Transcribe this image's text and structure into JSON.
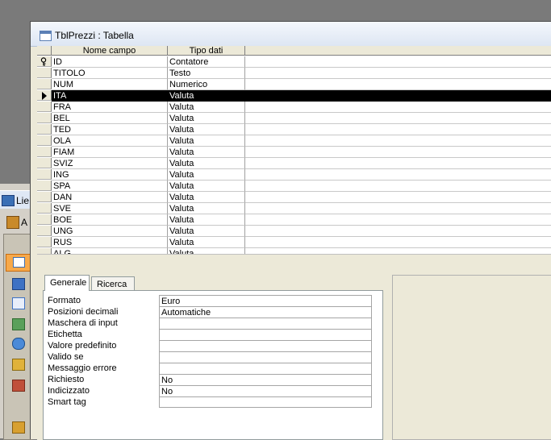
{
  "background_window": {
    "title_fragment": "Lie",
    "toolbar_fragment": "A",
    "object_icons": [
      "table-icon",
      "query-icon",
      "form-icon",
      "report-icon",
      "page-icon",
      "macro-icon",
      "module-icon"
    ]
  },
  "window": {
    "title": "TblPrezzi : Tabella"
  },
  "grid": {
    "headers": [
      "Nome campo",
      "Tipo dati"
    ],
    "rows": [
      {
        "name": "ID",
        "type": "Contatore",
        "key": true
      },
      {
        "name": "TITOLO",
        "type": "Testo"
      },
      {
        "name": "NUM",
        "type": "Numerico"
      },
      {
        "name": "ITA",
        "type": "Valuta",
        "active": true
      },
      {
        "name": "FRA",
        "type": "Valuta"
      },
      {
        "name": "BEL",
        "type": "Valuta"
      },
      {
        "name": "TED",
        "type": "Valuta"
      },
      {
        "name": "OLA",
        "type": "Valuta"
      },
      {
        "name": "FIAM",
        "type": "Valuta"
      },
      {
        "name": "SVIZ",
        "type": "Valuta"
      },
      {
        "name": "ING",
        "type": "Valuta"
      },
      {
        "name": "SPA",
        "type": "Valuta"
      },
      {
        "name": "DAN",
        "type": "Valuta"
      },
      {
        "name": "SVE",
        "type": "Valuta"
      },
      {
        "name": "BOE",
        "type": "Valuta"
      },
      {
        "name": "UNG",
        "type": "Valuta"
      },
      {
        "name": "RUS",
        "type": "Valuta"
      },
      {
        "name": "ALG",
        "type": "Valuta"
      }
    ]
  },
  "properties": {
    "tabs": [
      "Generale",
      "Ricerca"
    ],
    "fields": [
      {
        "label": "Formato",
        "value": "Euro"
      },
      {
        "label": "Posizioni decimali",
        "value": "Automatiche"
      },
      {
        "label": "Maschera di input",
        "value": ""
      },
      {
        "label": "Etichetta",
        "value": ""
      },
      {
        "label": "Valore predefinito",
        "value": ""
      },
      {
        "label": "Valido se",
        "value": ""
      },
      {
        "label": "Messaggio errore",
        "value": ""
      },
      {
        "label": "Richiesto",
        "value": "No"
      },
      {
        "label": "Indicizzato",
        "value": "No"
      },
      {
        "label": "Smart tag",
        "value": ""
      }
    ]
  },
  "colors": {
    "selected_row": "#000000",
    "selected_object": "#f7a94a"
  }
}
